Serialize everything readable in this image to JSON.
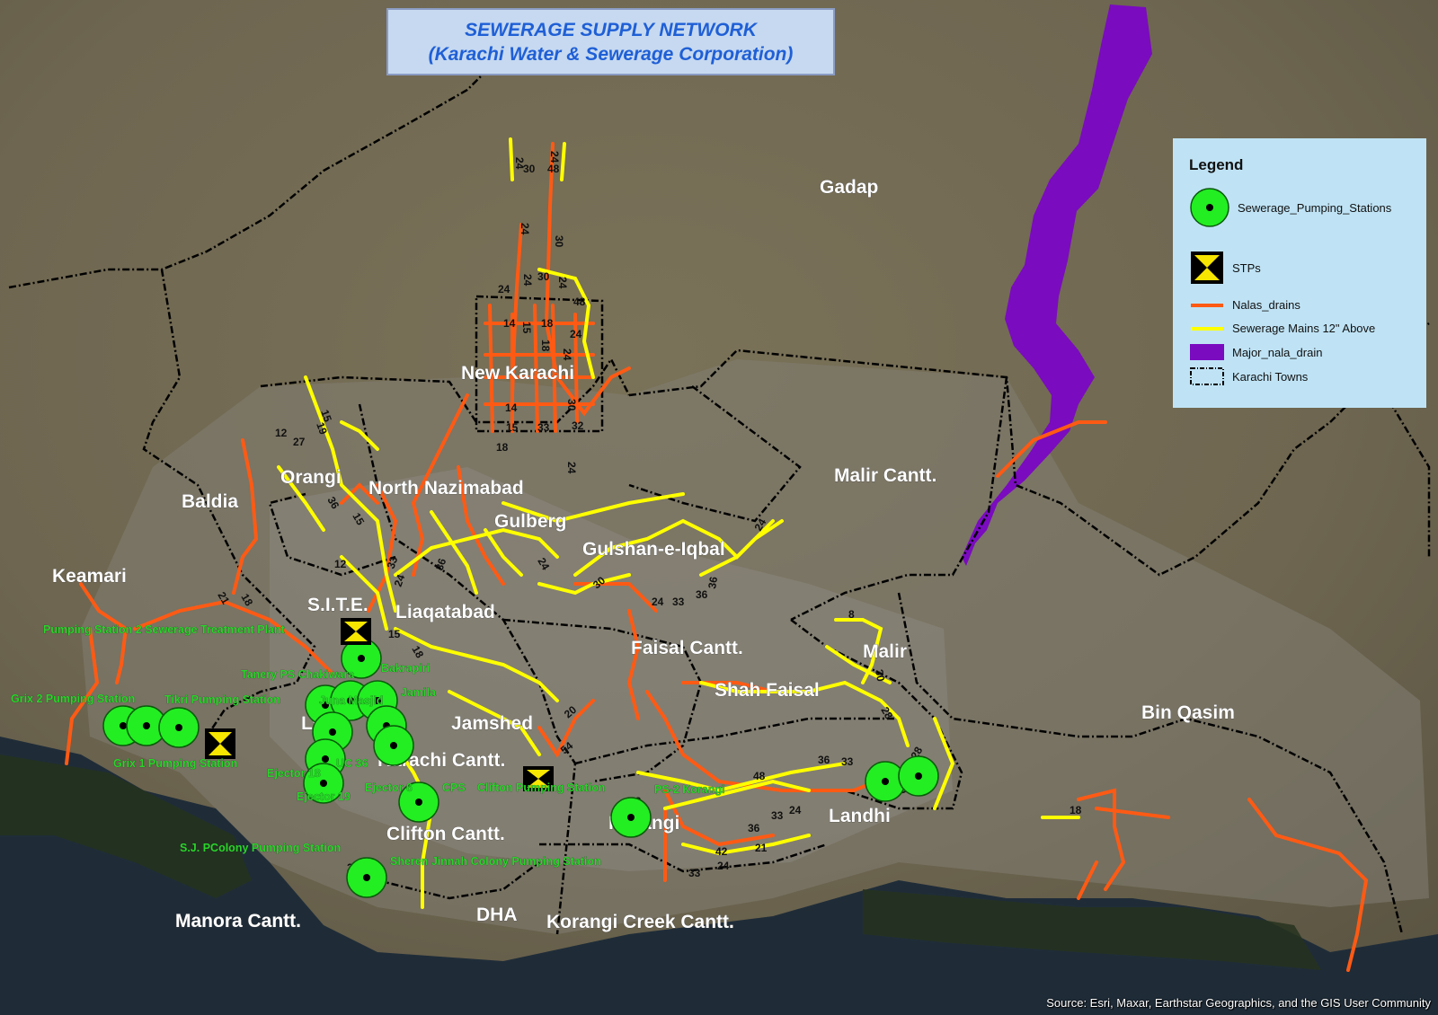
{
  "title": {
    "line1": "SEWERAGE SUPPLY NETWORK",
    "line2": "(Karachi Water & Sewerage Corporation)"
  },
  "legend": {
    "heading": "Legend",
    "items": [
      {
        "label": "Sewerage_Pumping_Stations",
        "symbol": "pumping-station-icon",
        "color": "#22ee22"
      },
      {
        "label": "STPs",
        "symbol": "stp-icon",
        "color": "#f7e600"
      },
      {
        "label": "Nalas_drains",
        "symbol": "orange-line",
        "color": "#ff5a14"
      },
      {
        "label": "Sewerage Mains 12\" Above",
        "symbol": "yellow-line",
        "color": "#ffff00"
      },
      {
        "label": "Major_nala_drain",
        "symbol": "purple-fill",
        "color": "#7a0bbf"
      },
      {
        "label": "Karachi Towns",
        "symbol": "dashed-boundary",
        "color": "#000000"
      }
    ]
  },
  "towns": [
    "Gadap",
    "New Karachi",
    "Malir Cantt.",
    "Orangi",
    "North Nazimabad",
    "Baldia",
    "Gulberg",
    "Gulshan-e-Iqbal",
    "Keamari",
    "S.I.T.E.",
    "Liaqatabad",
    "Faisal Cantt.",
    "Malir",
    "Shah Faisal",
    "Lyari",
    "Jamshed",
    "Bin Qasim",
    "Karachi Cantt.",
    "Korangi",
    "Landhi",
    "Clifton Cantt.",
    "Manora Cantt.",
    "DHA",
    "Korangi Creek Cantt."
  ],
  "stations": [
    "Pumping Station 2 Sewerage Treatment Plant",
    "Tanery PS Chakiwara",
    "Bakrapiri",
    "Jamila",
    "Grix 2 Pumping Station",
    "Tikri Pumping Station",
    "Juna Masjid",
    "Grix 1 Pumping Station",
    "UC 36",
    "Ejector 18",
    "Ejector 6",
    "CPS",
    "Clifton Pumping Station",
    "Ejector 19",
    "PS-2 Korangi",
    "S.J. PColony Pumping Station",
    "Sheren Jinnah Colony Pumping Station"
  ],
  "pipe_labels": [
    "24",
    "30",
    "48",
    "24",
    "30",
    "24",
    "24",
    "30",
    "24",
    "48",
    "24",
    "14",
    "15",
    "18",
    "18",
    "24",
    "24",
    "14",
    "15",
    "30",
    "33",
    "32",
    "24",
    "19",
    "12",
    "27",
    "18",
    "15",
    "36",
    "12",
    "15",
    "33",
    "24",
    "36",
    "24",
    "21",
    "18",
    "15",
    "18",
    "24",
    "33",
    "36",
    "36",
    "30",
    "24",
    "8",
    "30",
    "28",
    "20",
    "54",
    "36",
    "33",
    "48",
    "24",
    "33",
    "36",
    "42",
    "21",
    "24",
    "33",
    "27",
    "30",
    "28",
    "18",
    "24",
    "24",
    "18",
    "36",
    "8",
    "4"
  ],
  "attribution": "Source: Esri, Maxar, Earthstar Geographics, and the GIS User Community"
}
